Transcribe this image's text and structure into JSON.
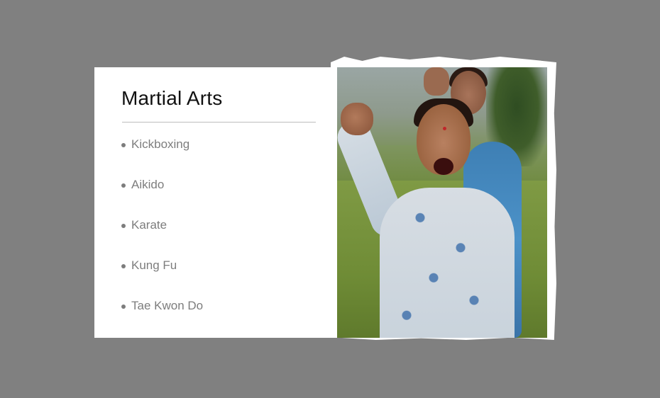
{
  "slide": {
    "title": "Martial Arts",
    "bullets": [
      "Kickboxing",
      "Aikido",
      "Karate",
      "Kung Fu",
      "Tae Kwon Do"
    ]
  },
  "colors": {
    "background": "#808080",
    "slide": "#ffffff",
    "title_text": "#111111",
    "bullet_text": "#7d7d7d",
    "divider": "#bdbdbd"
  }
}
